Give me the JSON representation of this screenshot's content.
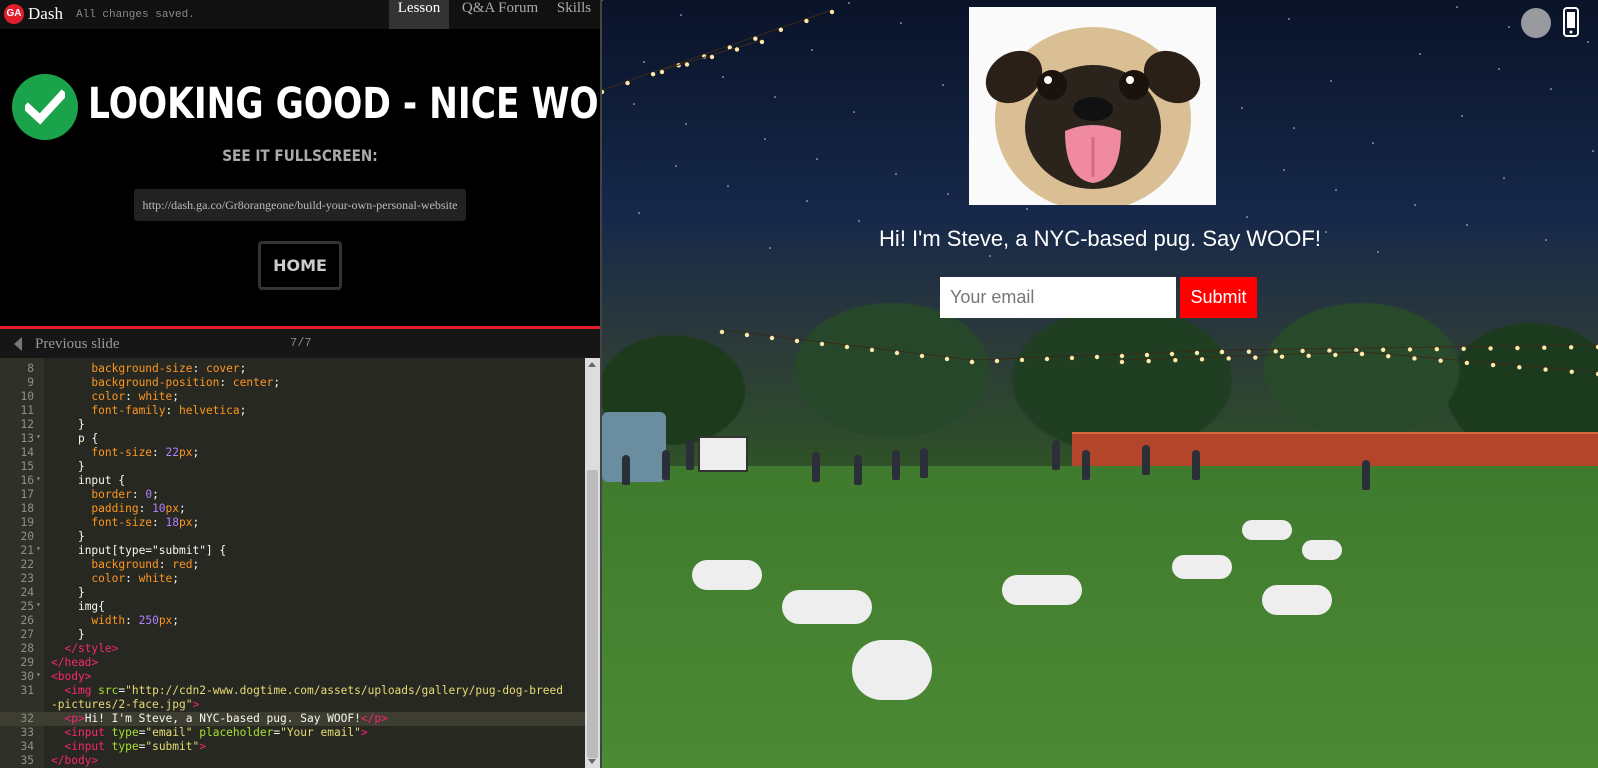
{
  "topbar": {
    "logo_text": "GA",
    "app_name": "Dash",
    "save_status": "All changes saved.",
    "tabs": [
      {
        "label": "Lesson",
        "active": true
      },
      {
        "label": "Q&A Forum",
        "active": false
      },
      {
        "label": "Skills",
        "active": false
      }
    ]
  },
  "success_panel": {
    "title": "LOOKING GOOD - NICE WORK!",
    "fullscreen_label": "SEE IT FULLSCREEN:",
    "fullscreen_url": "http://dash.ga.co/Gr8orangeone/build-your-own-personal-website",
    "home_label": "HOME",
    "check_color": "#1aa34a"
  },
  "slide_nav": {
    "prev_label": "Previous slide",
    "counter": "7/7"
  },
  "editor": {
    "active_line": 32,
    "lines": [
      {
        "n": "8",
        "fold": false,
        "segs": [
          [
            "",
            "      "
          ],
          [
            "prop",
            "background-size"
          ],
          [
            "",
            ": "
          ],
          [
            "kw",
            "cover"
          ],
          [
            "",
            ";"
          ]
        ]
      },
      {
        "n": "9",
        "fold": false,
        "segs": [
          [
            "",
            "      "
          ],
          [
            "prop",
            "background-position"
          ],
          [
            "",
            ": "
          ],
          [
            "kw",
            "center"
          ],
          [
            "",
            ";"
          ]
        ]
      },
      {
        "n": "10",
        "fold": false,
        "segs": [
          [
            "",
            "      "
          ],
          [
            "prop",
            "color"
          ],
          [
            "",
            ": "
          ],
          [
            "kw",
            "white"
          ],
          [
            "",
            ";"
          ]
        ]
      },
      {
        "n": "11",
        "fold": false,
        "segs": [
          [
            "",
            "      "
          ],
          [
            "prop",
            "font-family"
          ],
          [
            "",
            ": "
          ],
          [
            "kw",
            "helvetica"
          ],
          [
            "",
            ";"
          ]
        ]
      },
      {
        "n": "12",
        "fold": false,
        "segs": [
          [
            "",
            "    }"
          ]
        ]
      },
      {
        "n": "13",
        "fold": true,
        "segs": [
          [
            "",
            "    "
          ],
          [
            "sel",
            "p"
          ],
          [
            "",
            " {"
          ]
        ]
      },
      {
        "n": "14",
        "fold": false,
        "segs": [
          [
            "",
            "      "
          ],
          [
            "prop",
            "font-size"
          ],
          [
            "",
            ": "
          ],
          [
            "num",
            "22"
          ],
          [
            "kw",
            "px"
          ],
          [
            "",
            ";"
          ]
        ]
      },
      {
        "n": "15",
        "fold": false,
        "segs": [
          [
            "",
            "    }"
          ]
        ]
      },
      {
        "n": "16",
        "fold": true,
        "segs": [
          [
            "",
            "    "
          ],
          [
            "sel",
            "input"
          ],
          [
            "",
            " {"
          ]
        ]
      },
      {
        "n": "17",
        "fold": false,
        "segs": [
          [
            "",
            "      "
          ],
          [
            "prop",
            "border"
          ],
          [
            "",
            ": "
          ],
          [
            "num",
            "0"
          ],
          [
            "",
            ";"
          ]
        ]
      },
      {
        "n": "18",
        "fold": false,
        "segs": [
          [
            "",
            "      "
          ],
          [
            "prop",
            "padding"
          ],
          [
            "",
            ": "
          ],
          [
            "num",
            "10"
          ],
          [
            "kw",
            "px"
          ],
          [
            "",
            ";"
          ]
        ]
      },
      {
        "n": "19",
        "fold": false,
        "segs": [
          [
            "",
            "      "
          ],
          [
            "prop",
            "font-size"
          ],
          [
            "",
            ": "
          ],
          [
            "num",
            "18"
          ],
          [
            "kw",
            "px"
          ],
          [
            "",
            ";"
          ]
        ]
      },
      {
        "n": "20",
        "fold": false,
        "segs": [
          [
            "",
            "    }"
          ]
        ]
      },
      {
        "n": "21",
        "fold": true,
        "segs": [
          [
            "",
            "    "
          ],
          [
            "sel",
            "input[type=\"submit\"]"
          ],
          [
            "",
            " {"
          ]
        ]
      },
      {
        "n": "22",
        "fold": false,
        "segs": [
          [
            "",
            "      "
          ],
          [
            "prop",
            "background"
          ],
          [
            "",
            ": "
          ],
          [
            "kw",
            "red"
          ],
          [
            "",
            ";"
          ]
        ]
      },
      {
        "n": "23",
        "fold": false,
        "segs": [
          [
            "",
            "      "
          ],
          [
            "prop",
            "color"
          ],
          [
            "",
            ": "
          ],
          [
            "kw",
            "white"
          ],
          [
            "",
            ";"
          ]
        ]
      },
      {
        "n": "24",
        "fold": false,
        "segs": [
          [
            "",
            "    }"
          ]
        ]
      },
      {
        "n": "25",
        "fold": true,
        "segs": [
          [
            "",
            "    "
          ],
          [
            "sel",
            "img{"
          ]
        ]
      },
      {
        "n": "26",
        "fold": false,
        "segs": [
          [
            "",
            "      "
          ],
          [
            "prop",
            "width"
          ],
          [
            "",
            ": "
          ],
          [
            "num",
            "250"
          ],
          [
            "kw",
            "px"
          ],
          [
            "",
            ";"
          ]
        ]
      },
      {
        "n": "27",
        "fold": false,
        "segs": [
          [
            "",
            "    }"
          ]
        ]
      },
      {
        "n": "28",
        "fold": false,
        "segs": [
          [
            "",
            "  "
          ],
          [
            "tag",
            "</style>"
          ]
        ]
      },
      {
        "n": "29",
        "fold": false,
        "segs": [
          [
            "tag",
            "</head>"
          ]
        ]
      },
      {
        "n": "30",
        "fold": true,
        "segs": [
          [
            "tag",
            "<body>"
          ]
        ]
      },
      {
        "n": "31",
        "fold": false,
        "segs": [
          [
            "",
            "  "
          ],
          [
            "tag",
            "<img "
          ],
          [
            "attr",
            "src"
          ],
          [
            "",
            "="
          ],
          [
            "str",
            "\"http://cdn2-www.dogtime.com/assets/uploads/gallery/pug-dog-breed"
          ]
        ]
      },
      {
        "n": "",
        "fold": false,
        "segs": [
          [
            "str",
            "-pictures/2-face.jpg\""
          ],
          [
            "tag",
            ">"
          ]
        ]
      },
      {
        "n": "32",
        "fold": false,
        "segs": [
          [
            "",
            "  "
          ],
          [
            "tag",
            "<p>"
          ],
          [
            "",
            "Hi! I'm Steve, a NYC-based pug. Say WOOF!"
          ],
          [
            "tag",
            "</p>"
          ]
        ]
      },
      {
        "n": "33",
        "fold": false,
        "segs": [
          [
            "",
            "  "
          ],
          [
            "tag",
            "<input "
          ],
          [
            "attr",
            "type"
          ],
          [
            "",
            "="
          ],
          [
            "str",
            "\"email\""
          ],
          [
            "",
            ""
          ],
          [
            "attr",
            " placeholder"
          ],
          [
            "",
            "="
          ],
          [
            "str",
            "\"Your email\""
          ],
          [
            "tag",
            ">"
          ]
        ]
      },
      {
        "n": "34",
        "fold": false,
        "segs": [
          [
            "",
            "  "
          ],
          [
            "tag",
            "<input "
          ],
          [
            "attr",
            "type"
          ],
          [
            "",
            "="
          ],
          [
            "str",
            "\"submit\""
          ],
          [
            "tag",
            ">"
          ]
        ]
      },
      {
        "n": "35",
        "fold": false,
        "segs": [
          [
            "tag",
            "</body>"
          ]
        ]
      }
    ]
  },
  "preview": {
    "tagline": "Hi! I'm Steve, a NYC-based pug. Say WOOF!",
    "email_placeholder": "Your email",
    "submit_label": "Submit",
    "submit_color": "#ff0000",
    "pug_photo_icon": "pug-face-image"
  }
}
